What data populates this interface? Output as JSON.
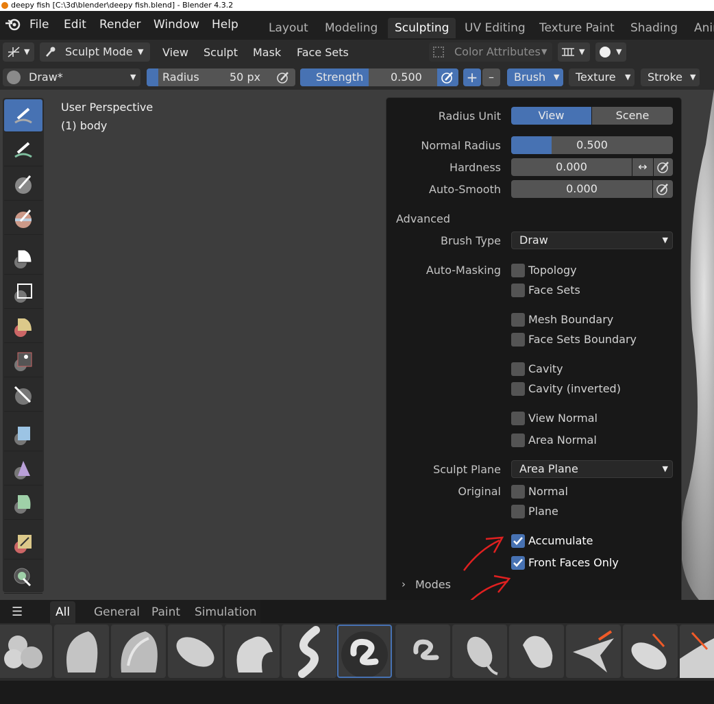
{
  "window_title": "deepy fish [C:\\3d\\blender\\deepy fish.blend] - Blender 4.3.2",
  "menu": [
    "File",
    "Edit",
    "Render",
    "Window",
    "Help"
  ],
  "workspaces": [
    "Layout",
    "Modeling",
    "Sculpting",
    "UV Editing",
    "Texture Paint",
    "Shading",
    "Anim"
  ],
  "header": {
    "mode": "Sculpt Mode",
    "view": "View",
    "sculpt": "Sculpt",
    "mask": "Mask",
    "face_sets": "Face Sets",
    "color_attributes": "Color Attributes"
  },
  "tool_settings": {
    "brush_name": "Draw*",
    "radius_label": "Radius",
    "radius_value": "50 px",
    "strength_label": "Strength",
    "strength_value": "0.500",
    "strength_fraction": 0.5,
    "plus": "+",
    "minus": "–",
    "brush_menu": "Brush",
    "texture_menu": "Texture",
    "stroke_menu": "Stroke"
  },
  "viewport": {
    "perspective": "User Perspective",
    "object": "(1) body"
  },
  "popup": {
    "radius_unit_label": "Radius Unit",
    "radius_unit_view": "View",
    "radius_unit_scene": "Scene",
    "normal_radius_label": "Normal Radius",
    "normal_radius_value": "0.500",
    "normal_radius_fraction": 0.25,
    "hardness_label": "Hardness",
    "hardness_value": "0.000",
    "auto_smooth_label": "Auto-Smooth",
    "auto_smooth_value": "0.000",
    "advanced_label": "Advanced",
    "brush_type_label": "Brush Type",
    "brush_type_value": "Draw",
    "auto_masking_label": "Auto-Masking",
    "automask": [
      "Topology",
      "Face Sets",
      "Mesh Boundary",
      "Face Sets Boundary",
      "Cavity",
      "Cavity (inverted)",
      "View Normal",
      "Area Normal"
    ],
    "sculpt_plane_label": "Sculpt Plane",
    "sculpt_plane_value": "Area Plane",
    "original_label": "Original",
    "original_normal": "Normal",
    "original_plane": "Plane",
    "accumulate": "Accumulate",
    "accumulate_checked": true,
    "front_faces_only": "Front Faces Only",
    "front_faces_checked": true,
    "modes_label": "Modes"
  },
  "shelf_tabs": [
    "All",
    "General",
    "Paint",
    "Simulation"
  ],
  "colors": {
    "accent": "#4772b3",
    "annotation": "#e02020"
  }
}
